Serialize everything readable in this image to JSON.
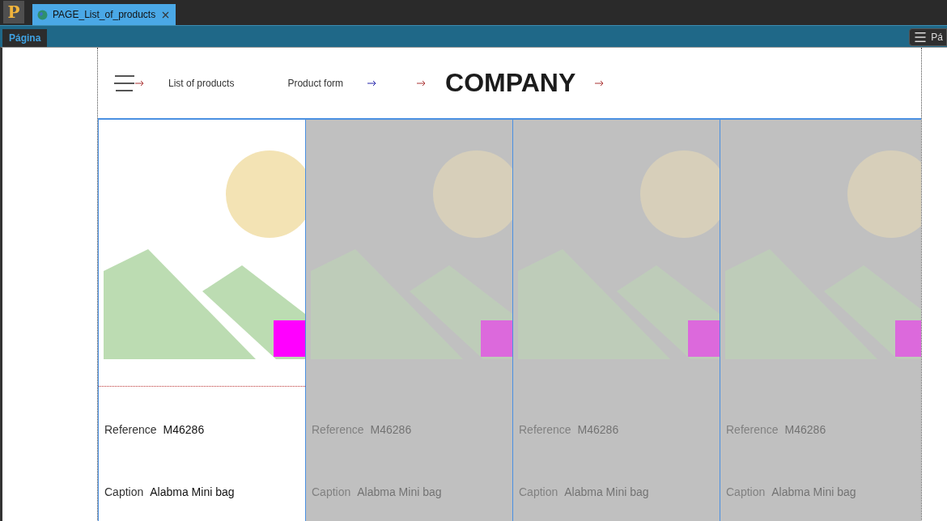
{
  "app_logo": "P",
  "document_tabs": [
    {
      "label": "PAGE_List_of_products",
      "selected": true
    }
  ],
  "ribbon": {
    "tabs": [
      {
        "label": "Página",
        "selected": true
      }
    ],
    "panel_button": "Pá"
  },
  "header": {
    "nav": [
      {
        "label": "List of products"
      },
      {
        "label": "Product form"
      }
    ],
    "brand": "COMPANY"
  },
  "products": [
    {
      "selected": true,
      "reference_label": "Reference",
      "reference": "M46286",
      "caption_label": "Caption",
      "caption": "Alabma Mini bag"
    },
    {
      "selected": false,
      "reference_label": "Reference",
      "reference": "M46286",
      "caption_label": "Caption",
      "caption": "Alabma Mini bag"
    },
    {
      "selected": false,
      "reference_label": "Reference",
      "reference": "M46286",
      "caption_label": "Caption",
      "caption": "Alabma Mini bag"
    },
    {
      "selected": false,
      "reference_label": "Reference",
      "reference": "M46286",
      "caption_label": "Caption",
      "caption": "Alabma Mini bag"
    }
  ]
}
